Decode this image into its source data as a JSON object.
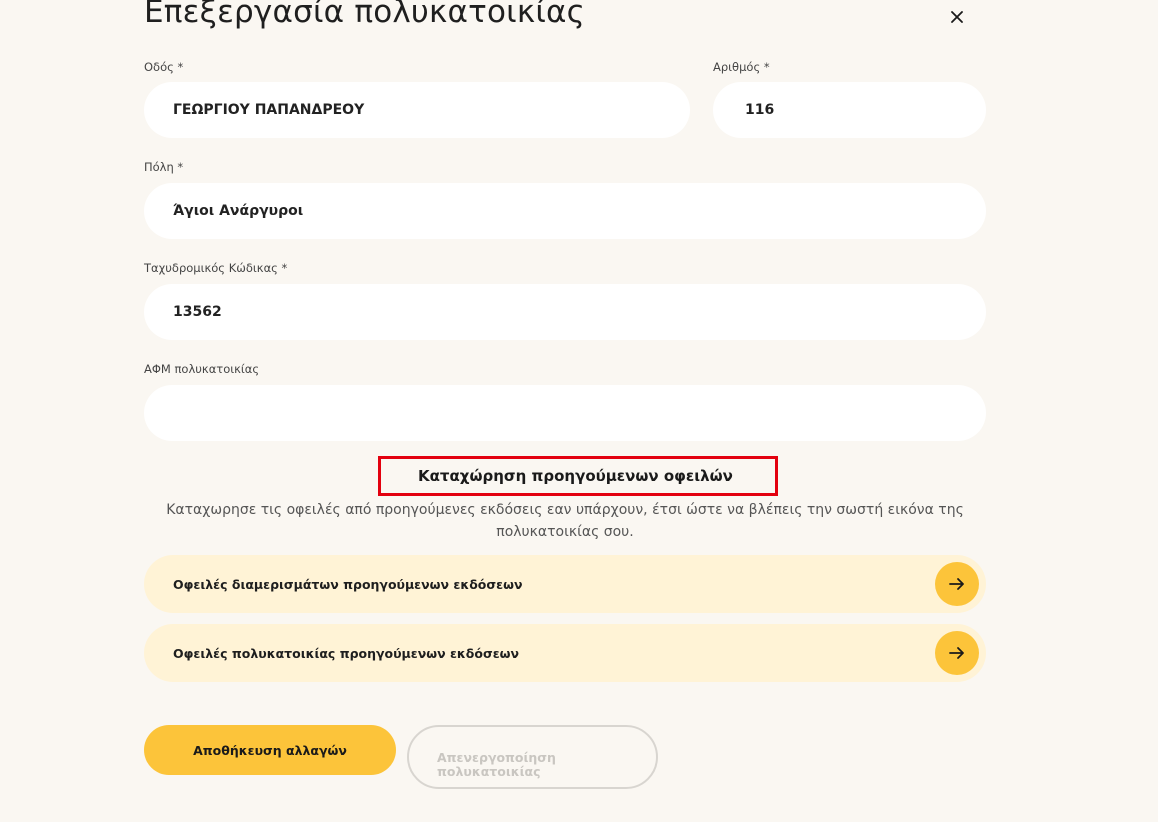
{
  "dialog": {
    "title": "Επεξεργασία πολυκατοικίας"
  },
  "form": {
    "street": {
      "label": "Οδός *",
      "value": "ΓΕΩΡΓΙΟΥ ΠΑΠΑΝΔΡΕΟΥ"
    },
    "number": {
      "label": "Αριθμός *",
      "value": "116"
    },
    "city": {
      "label": "Πόλη *",
      "value": "Άγιοι Ανάργυροι"
    },
    "postal_code": {
      "label": "Ταχυδρομικός Κώδικας *",
      "value": "13562"
    },
    "vat": {
      "label": "ΑΦΜ πολυκατοικίας",
      "value": ""
    }
  },
  "previous_debts": {
    "title": "Καταχώρηση προηγούμενων οφειλών",
    "description": "Καταχωρησε τις οφειλές από προηγούμενες εκδόσεις εαν υπάρχουν, έτσι ώστε να βλέπεις την σωστή εικόνα της πολυκατοικίας σου.",
    "items": [
      {
        "label": "Οφειλές διαμερισμάτων προηγούμενων εκδόσεων"
      },
      {
        "label": "Οφειλές πολυκατοικίας προηγούμενων εκδόσεων"
      }
    ]
  },
  "actions": {
    "save_label": "Αποθήκευση αλλαγών",
    "deactivate_label": "Απενεργοποίηση πολυκατοικίας"
  },
  "colors": {
    "accent": "#fcc43a",
    "debt_row_bg": "#fff3d6",
    "highlight_border": "#e3000f",
    "background": "#faf7f2"
  },
  "icons": {
    "close": "close-icon",
    "arrow": "arrow-right-icon"
  }
}
